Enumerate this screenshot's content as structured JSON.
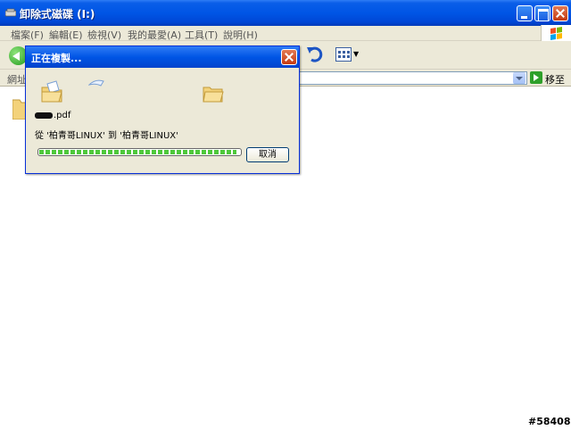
{
  "window": {
    "title": "卸除式磁碟 (I:)",
    "controls": [
      "minimize-icon",
      "maximize-icon",
      "close-icon"
    ]
  },
  "menu": {
    "items": [
      "檔案(F)",
      "編輯(E)",
      "檢視(V)",
      "我的最愛(A)",
      "工具(T)",
      "說明(H)"
    ]
  },
  "address": {
    "label": "網址",
    "go_label": "移至"
  },
  "dialog": {
    "title": "正在複製...",
    "file_name": ".pdf",
    "from_to": "從 '柏青哥LINUX' 到 '柏青哥LINUX'",
    "progress": 0.98,
    "cancel_label": "取消"
  },
  "watermark": "#58408",
  "colors": {
    "titlebar": "#0055e5",
    "progress": "#4ec83b",
    "chrome": "#ece9d8"
  }
}
